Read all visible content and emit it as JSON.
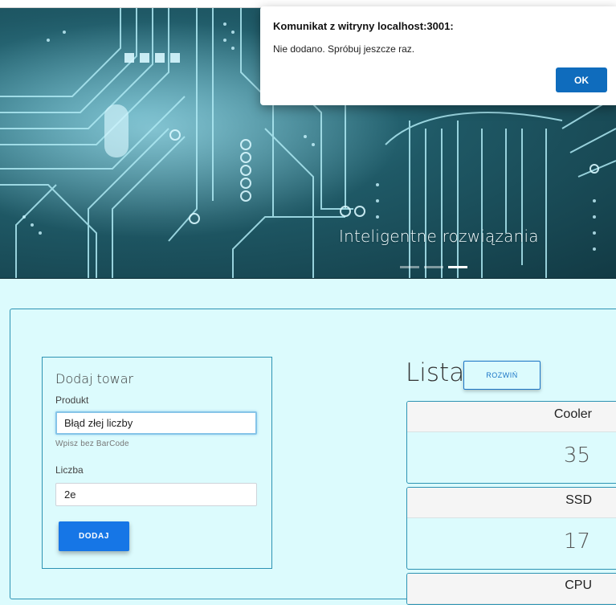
{
  "carousel": {
    "caption": "Inteligentne rozwiązania",
    "slide_count": 3,
    "active_slide": 3
  },
  "form": {
    "title": "Dodaj towar",
    "product_label": "Produkt",
    "product_value": "Błąd złej liczby",
    "product_hint": "Wpisz bez BarCode",
    "quantity_label": "Liczba",
    "quantity_value": "2e",
    "submit_label": "DODAJ"
  },
  "list": {
    "title": "Lista",
    "expand_label": "ROZWIŃ",
    "items": [
      {
        "name": "Cooler",
        "value": "35"
      },
      {
        "name": "SSD",
        "value": "17"
      },
      {
        "name": "CPU",
        "value": ""
      }
    ]
  },
  "dialog": {
    "title": "Komunikat z witryny localhost:3001:",
    "message": "Nie dodano. Spróbuj jeszcze raz.",
    "ok_label": "OK"
  },
  "colors": {
    "page_bg": "#dcfbfd",
    "border": "#2d93b3",
    "primary": "#1676e6",
    "dialog_ok": "#0f6cbd"
  }
}
